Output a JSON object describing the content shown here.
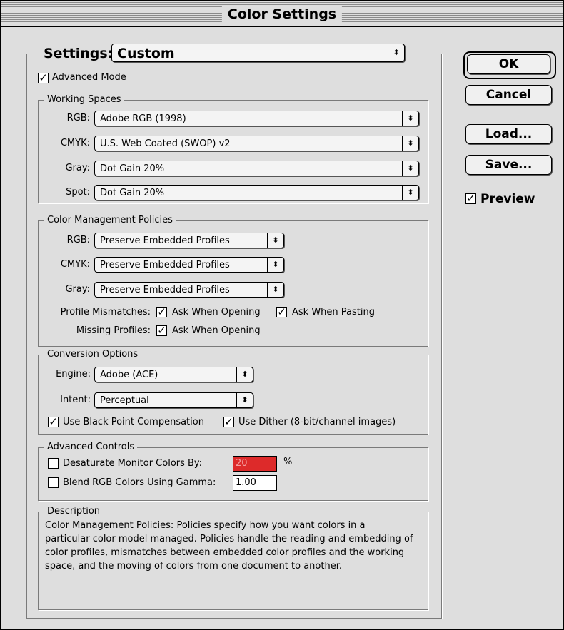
{
  "window": {
    "title": "Color Settings"
  },
  "settings": {
    "label": "Settings:",
    "value": "Custom"
  },
  "advanced_mode": {
    "label": "Advanced Mode",
    "checked": true
  },
  "working_spaces": {
    "title": "Working Spaces",
    "rgb": {
      "label": "RGB:",
      "value": "Adobe RGB (1998)"
    },
    "cmyk": {
      "label": "CMYK:",
      "value": "U.S. Web Coated (SWOP) v2"
    },
    "gray": {
      "label": "Gray:",
      "value": "Dot Gain 20%"
    },
    "spot": {
      "label": "Spot:",
      "value": "Dot Gain 20%"
    }
  },
  "policies": {
    "title": "Color Management Policies",
    "rgb": {
      "label": "RGB:",
      "value": "Preserve Embedded Profiles"
    },
    "cmyk": {
      "label": "CMYK:",
      "value": "Preserve Embedded Profiles"
    },
    "gray": {
      "label": "Gray:",
      "value": "Preserve Embedded Profiles"
    },
    "mismatches_label": "Profile Mismatches:",
    "ask_opening": {
      "label": "Ask When Opening",
      "checked": true
    },
    "ask_pasting": {
      "label": "Ask When Pasting",
      "checked": true
    },
    "missing_label": "Missing Profiles:",
    "missing_ask_opening": {
      "label": "Ask When Opening",
      "checked": true
    }
  },
  "conversion": {
    "title": "Conversion Options",
    "engine": {
      "label": "Engine:",
      "value": "Adobe (ACE)"
    },
    "intent": {
      "label": "Intent:",
      "value": "Perceptual"
    },
    "black_point": {
      "label": "Use Black Point Compensation",
      "checked": true
    },
    "dither": {
      "label": "Use Dither (8-bit/channel images)",
      "checked": true
    }
  },
  "advanced": {
    "title": "Advanced Controls",
    "desaturate": {
      "label": "Desaturate Monitor Colors By:",
      "checked": false,
      "value": "20",
      "unit": "%",
      "field_color": "#dd2a2a"
    },
    "blend": {
      "label": "Blend RGB Colors Using Gamma:",
      "checked": false,
      "value": "1.00"
    }
  },
  "description": {
    "title": "Description",
    "line1": "Color Management Policies:  Policies specify how you want colors in a",
    "line2": "particular color model managed.  Policies handle the reading and embedding of",
    "line3": "color profiles, mismatches between embedded color profiles and the working",
    "line4": "space, and the moving of colors from one document to another."
  },
  "buttons": {
    "ok": "OK",
    "cancel": "Cancel",
    "load": "Load...",
    "save": "Save..."
  },
  "preview": {
    "label": "Preview",
    "checked": true
  },
  "glyphs": {
    "check": "✓",
    "popup_arrows": "⬍"
  }
}
